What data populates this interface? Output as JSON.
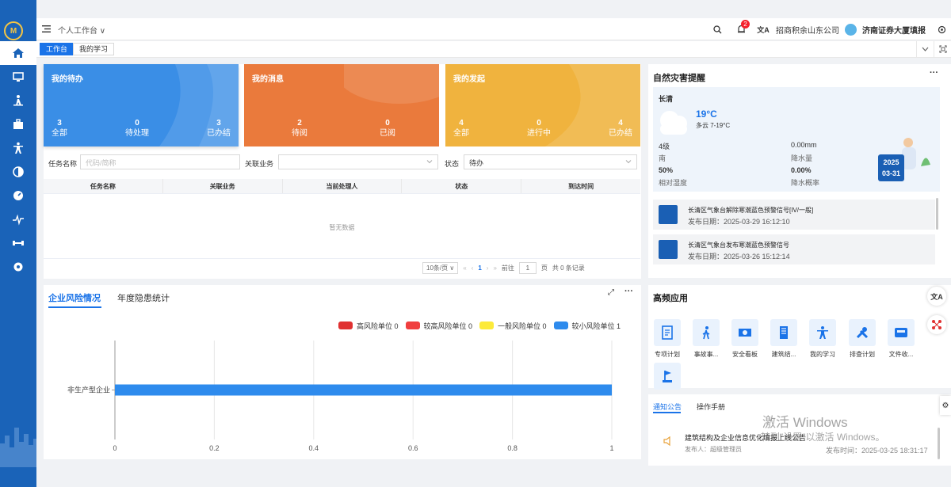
{
  "header": {
    "title": "个人工作台",
    "notification_count": "2",
    "company": "招商积余山东公司",
    "project": "济南证券大厦填报"
  },
  "tabs": [
    "工作台",
    "我的学习"
  ],
  "cards": [
    {
      "title": "我的待办",
      "stats": [
        {
          "value": "3",
          "label": "全部"
        },
        {
          "value": "0",
          "label": "待处理"
        },
        {
          "value": "3",
          "label": "已办结"
        }
      ],
      "color": "#3a8ee6"
    },
    {
      "title": "我的消息",
      "stats": [
        {
          "value": "2",
          "label": "待阅"
        },
        {
          "value": "0",
          "label": "已阅"
        }
      ],
      "color": "#ea7a3c"
    },
    {
      "title": "我的发起",
      "stats": [
        {
          "value": "4",
          "label": "全部"
        },
        {
          "value": "0",
          "label": "进行中"
        },
        {
          "value": "4",
          "label": "已办结"
        }
      ],
      "color": "#f0b33e"
    }
  ],
  "filter": {
    "task_label": "任务名称",
    "task_placeholder": "代码/简称",
    "business_label": "关联业务",
    "business_value": "",
    "status_label": "状态",
    "status_value": "待办"
  },
  "table": {
    "columns": [
      "任务名称",
      "关联业务",
      "当前处理人",
      "状态",
      "到达时间"
    ],
    "empty_text": "暂无数据"
  },
  "pager": {
    "page_size": "10条/页",
    "current_page": "1",
    "goto_label": "前往",
    "goto_value": "1",
    "page_suffix": "页",
    "total": "共 0 条记录"
  },
  "risk": {
    "tabs": [
      "企业风险情况",
      "年度隐患统计"
    ],
    "active_tab": 0
  },
  "chart_data": {
    "type": "bar",
    "orientation": "horizontal",
    "categories": [
      "非生产型企业"
    ],
    "series": [
      {
        "name": "高风险单位 0",
        "values": [
          0
        ],
        "color": "#e03131"
      },
      {
        "name": "较高风险单位 0",
        "values": [
          0
        ],
        "color": "#f03e3e"
      },
      {
        "name": "一般风险单位 0",
        "values": [
          0
        ],
        "color": "#fcea3a"
      },
      {
        "name": "较小风险单位 1",
        "values": [
          1
        ],
        "color": "#2e8bed"
      }
    ],
    "xlim": [
      0,
      1
    ],
    "xticks": [
      "0",
      "0.2",
      "0.4",
      "0.6",
      "0.8",
      "1"
    ],
    "grid": true,
    "legend": "top-right",
    "title": "",
    "xlabel": "",
    "ylabel": ""
  },
  "weather": {
    "title": "自然灾害提醒",
    "city": "长清",
    "temp": "19°C",
    "desc": "多云 7-19°C",
    "wind_level": "4级",
    "wind_dir": "南",
    "rain": "0.00mm",
    "rain_label": "降水量",
    "humidity": "50%",
    "humidity_label": "相对湿度",
    "rain_prob": "0.00%",
    "rain_prob_label": "降水概率",
    "date_year": "2025",
    "date_md": "03-31"
  },
  "notices": [
    {
      "title": "长清区气象台解除寒潮蓝色预警信号[IV/一般]",
      "date": "发布日期：2025-03-29 16:12:10"
    },
    {
      "title": "长清区气象台发布寒潮蓝色预警信号",
      "date": "发布日期：2025-03-26 15:12:14"
    }
  ],
  "apps": {
    "title": "高频应用",
    "items": [
      {
        "label": "专项计划",
        "icon": "document-icon"
      },
      {
        "label": "事故事...",
        "icon": "walking-person-icon"
      },
      {
        "label": "安全看板",
        "icon": "money-icon"
      },
      {
        "label": "建筑结...",
        "icon": "building-icon"
      },
      {
        "label": "我的学习",
        "icon": "person-icon"
      },
      {
        "label": "排查计划",
        "icon": "tools-icon"
      },
      {
        "label": "文件收...",
        "icon": "inbox-icon"
      },
      {
        "label": "",
        "icon": "flag-icon"
      }
    ]
  },
  "announcements": {
    "tabs": [
      "通知公告",
      "操作手册"
    ],
    "item_title": "建筑结构及企业信息优化填报上线公告",
    "publisher": "发布人：超级管理员",
    "time": "发布时间：2025-03-25 18:31:17"
  },
  "watermark": {
    "line1": "激活 Windows",
    "line2": "转到\"设置\"以激活 Windows。"
  }
}
